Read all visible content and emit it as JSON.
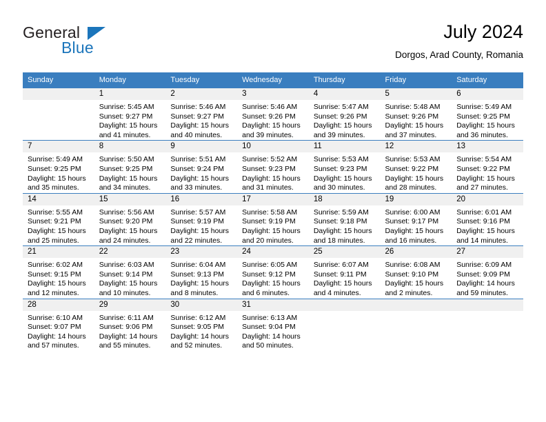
{
  "brand": {
    "name_part1": "General",
    "name_part2": "Blue",
    "triangle_icon": "triangle-icon",
    "accent_color": "#1b75bb"
  },
  "header": {
    "month_title": "July 2024",
    "location": "Dorgos, Arad County, Romania"
  },
  "calendar": {
    "header_color": "#3a7ebf",
    "daynum_band_color": "#f0f0f0",
    "weekday_headers": [
      "Sunday",
      "Monday",
      "Tuesday",
      "Wednesday",
      "Thursday",
      "Friday",
      "Saturday"
    ],
    "weeks": [
      [
        {
          "day": "",
          "sunrise": "",
          "sunset": "",
          "daylight_line1": "",
          "daylight_line2": ""
        },
        {
          "day": "1",
          "sunrise": "Sunrise: 5:45 AM",
          "sunset": "Sunset: 9:27 PM",
          "daylight_line1": "Daylight: 15 hours",
          "daylight_line2": "and 41 minutes."
        },
        {
          "day": "2",
          "sunrise": "Sunrise: 5:46 AM",
          "sunset": "Sunset: 9:27 PM",
          "daylight_line1": "Daylight: 15 hours",
          "daylight_line2": "and 40 minutes."
        },
        {
          "day": "3",
          "sunrise": "Sunrise: 5:46 AM",
          "sunset": "Sunset: 9:26 PM",
          "daylight_line1": "Daylight: 15 hours",
          "daylight_line2": "and 39 minutes."
        },
        {
          "day": "4",
          "sunrise": "Sunrise: 5:47 AM",
          "sunset": "Sunset: 9:26 PM",
          "daylight_line1": "Daylight: 15 hours",
          "daylight_line2": "and 39 minutes."
        },
        {
          "day": "5",
          "sunrise": "Sunrise: 5:48 AM",
          "sunset": "Sunset: 9:26 PM",
          "daylight_line1": "Daylight: 15 hours",
          "daylight_line2": "and 37 minutes."
        },
        {
          "day": "6",
          "sunrise": "Sunrise: 5:49 AM",
          "sunset": "Sunset: 9:25 PM",
          "daylight_line1": "Daylight: 15 hours",
          "daylight_line2": "and 36 minutes."
        }
      ],
      [
        {
          "day": "7",
          "sunrise": "Sunrise: 5:49 AM",
          "sunset": "Sunset: 9:25 PM",
          "daylight_line1": "Daylight: 15 hours",
          "daylight_line2": "and 35 minutes."
        },
        {
          "day": "8",
          "sunrise": "Sunrise: 5:50 AM",
          "sunset": "Sunset: 9:25 PM",
          "daylight_line1": "Daylight: 15 hours",
          "daylight_line2": "and 34 minutes."
        },
        {
          "day": "9",
          "sunrise": "Sunrise: 5:51 AM",
          "sunset": "Sunset: 9:24 PM",
          "daylight_line1": "Daylight: 15 hours",
          "daylight_line2": "and 33 minutes."
        },
        {
          "day": "10",
          "sunrise": "Sunrise: 5:52 AM",
          "sunset": "Sunset: 9:23 PM",
          "daylight_line1": "Daylight: 15 hours",
          "daylight_line2": "and 31 minutes."
        },
        {
          "day": "11",
          "sunrise": "Sunrise: 5:53 AM",
          "sunset": "Sunset: 9:23 PM",
          "daylight_line1": "Daylight: 15 hours",
          "daylight_line2": "and 30 minutes."
        },
        {
          "day": "12",
          "sunrise": "Sunrise: 5:53 AM",
          "sunset": "Sunset: 9:22 PM",
          "daylight_line1": "Daylight: 15 hours",
          "daylight_line2": "and 28 minutes."
        },
        {
          "day": "13",
          "sunrise": "Sunrise: 5:54 AM",
          "sunset": "Sunset: 9:22 PM",
          "daylight_line1": "Daylight: 15 hours",
          "daylight_line2": "and 27 minutes."
        }
      ],
      [
        {
          "day": "14",
          "sunrise": "Sunrise: 5:55 AM",
          "sunset": "Sunset: 9:21 PM",
          "daylight_line1": "Daylight: 15 hours",
          "daylight_line2": "and 25 minutes."
        },
        {
          "day": "15",
          "sunrise": "Sunrise: 5:56 AM",
          "sunset": "Sunset: 9:20 PM",
          "daylight_line1": "Daylight: 15 hours",
          "daylight_line2": "and 24 minutes."
        },
        {
          "day": "16",
          "sunrise": "Sunrise: 5:57 AM",
          "sunset": "Sunset: 9:19 PM",
          "daylight_line1": "Daylight: 15 hours",
          "daylight_line2": "and 22 minutes."
        },
        {
          "day": "17",
          "sunrise": "Sunrise: 5:58 AM",
          "sunset": "Sunset: 9:19 PM",
          "daylight_line1": "Daylight: 15 hours",
          "daylight_line2": "and 20 minutes."
        },
        {
          "day": "18",
          "sunrise": "Sunrise: 5:59 AM",
          "sunset": "Sunset: 9:18 PM",
          "daylight_line1": "Daylight: 15 hours",
          "daylight_line2": "and 18 minutes."
        },
        {
          "day": "19",
          "sunrise": "Sunrise: 6:00 AM",
          "sunset": "Sunset: 9:17 PM",
          "daylight_line1": "Daylight: 15 hours",
          "daylight_line2": "and 16 minutes."
        },
        {
          "day": "20",
          "sunrise": "Sunrise: 6:01 AM",
          "sunset": "Sunset: 9:16 PM",
          "daylight_line1": "Daylight: 15 hours",
          "daylight_line2": "and 14 minutes."
        }
      ],
      [
        {
          "day": "21",
          "sunrise": "Sunrise: 6:02 AM",
          "sunset": "Sunset: 9:15 PM",
          "daylight_line1": "Daylight: 15 hours",
          "daylight_line2": "and 12 minutes."
        },
        {
          "day": "22",
          "sunrise": "Sunrise: 6:03 AM",
          "sunset": "Sunset: 9:14 PM",
          "daylight_line1": "Daylight: 15 hours",
          "daylight_line2": "and 10 minutes."
        },
        {
          "day": "23",
          "sunrise": "Sunrise: 6:04 AM",
          "sunset": "Sunset: 9:13 PM",
          "daylight_line1": "Daylight: 15 hours",
          "daylight_line2": "and 8 minutes."
        },
        {
          "day": "24",
          "sunrise": "Sunrise: 6:05 AM",
          "sunset": "Sunset: 9:12 PM",
          "daylight_line1": "Daylight: 15 hours",
          "daylight_line2": "and 6 minutes."
        },
        {
          "day": "25",
          "sunrise": "Sunrise: 6:07 AM",
          "sunset": "Sunset: 9:11 PM",
          "daylight_line1": "Daylight: 15 hours",
          "daylight_line2": "and 4 minutes."
        },
        {
          "day": "26",
          "sunrise": "Sunrise: 6:08 AM",
          "sunset": "Sunset: 9:10 PM",
          "daylight_line1": "Daylight: 15 hours",
          "daylight_line2": "and 2 minutes."
        },
        {
          "day": "27",
          "sunrise": "Sunrise: 6:09 AM",
          "sunset": "Sunset: 9:09 PM",
          "daylight_line1": "Daylight: 14 hours",
          "daylight_line2": "and 59 minutes."
        }
      ],
      [
        {
          "day": "28",
          "sunrise": "Sunrise: 6:10 AM",
          "sunset": "Sunset: 9:07 PM",
          "daylight_line1": "Daylight: 14 hours",
          "daylight_line2": "and 57 minutes."
        },
        {
          "day": "29",
          "sunrise": "Sunrise: 6:11 AM",
          "sunset": "Sunset: 9:06 PM",
          "daylight_line1": "Daylight: 14 hours",
          "daylight_line2": "and 55 minutes."
        },
        {
          "day": "30",
          "sunrise": "Sunrise: 6:12 AM",
          "sunset": "Sunset: 9:05 PM",
          "daylight_line1": "Daylight: 14 hours",
          "daylight_line2": "and 52 minutes."
        },
        {
          "day": "31",
          "sunrise": "Sunrise: 6:13 AM",
          "sunset": "Sunset: 9:04 PM",
          "daylight_line1": "Daylight: 14 hours",
          "daylight_line2": "and 50 minutes."
        },
        {
          "day": "",
          "sunrise": "",
          "sunset": "",
          "daylight_line1": "",
          "daylight_line2": ""
        },
        {
          "day": "",
          "sunrise": "",
          "sunset": "",
          "daylight_line1": "",
          "daylight_line2": ""
        },
        {
          "day": "",
          "sunrise": "",
          "sunset": "",
          "daylight_line1": "",
          "daylight_line2": ""
        }
      ]
    ]
  }
}
